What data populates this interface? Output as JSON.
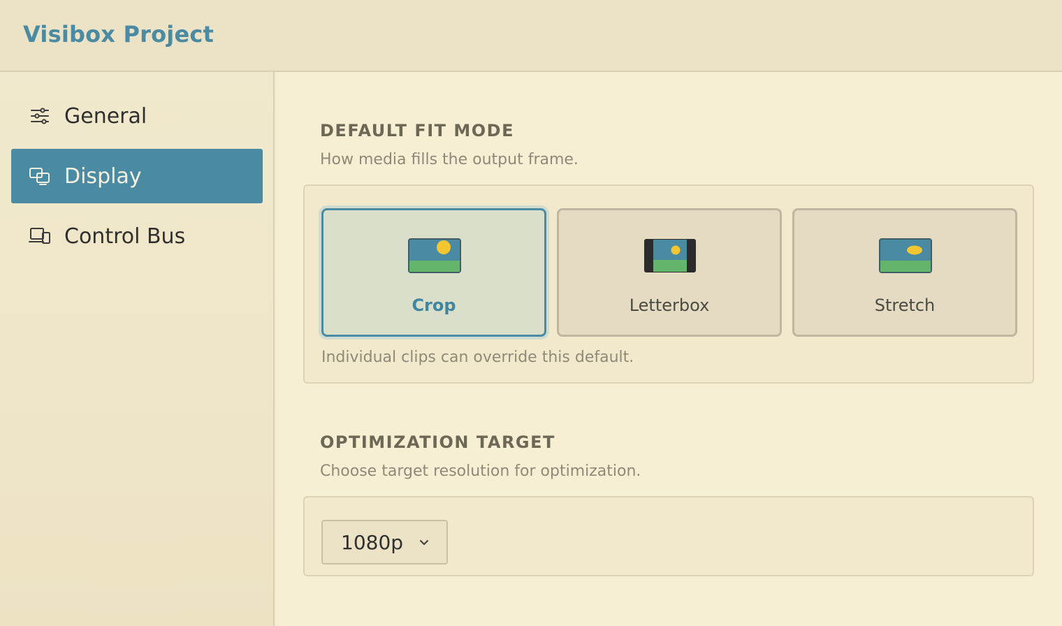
{
  "app": {
    "title": "Visibox Project"
  },
  "sidebar": {
    "items": [
      {
        "label": "General",
        "icon": "sliders-icon",
        "active": false
      },
      {
        "label": "Display",
        "icon": "display-icon",
        "active": true
      },
      {
        "label": "Control Bus",
        "icon": "devices-icon",
        "active": false
      }
    ]
  },
  "fit_mode": {
    "title": "DEFAULT FIT MODE",
    "description": "How media fills the output frame.",
    "options": [
      {
        "label": "Crop",
        "icon": "crop-thumbnail-icon",
        "selected": true
      },
      {
        "label": "Letterbox",
        "icon": "letterbox-thumbnail-icon",
        "selected": false
      },
      {
        "label": "Stretch",
        "icon": "stretch-thumbnail-icon",
        "selected": false
      }
    ],
    "note": "Individual clips can override this default."
  },
  "optimization": {
    "title": "OPTIMIZATION TARGET",
    "description": "Choose target resolution for optimization.",
    "selected": "1080p"
  },
  "colors": {
    "accent": "#4a8aa2",
    "background": "#f6efd4",
    "sky": "#4a8aa2",
    "grass": "#62b56a",
    "sun": "#f2c531"
  }
}
